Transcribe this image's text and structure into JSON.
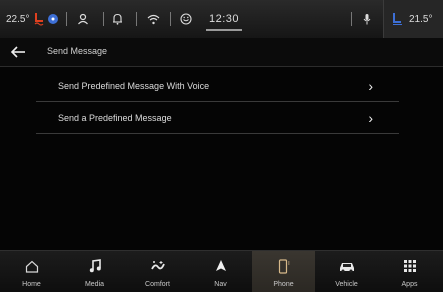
{
  "status": {
    "temp_left": "22.5°",
    "clock": "12:30",
    "temp_right": "21.5°"
  },
  "header": {
    "title": "Send Message"
  },
  "menu": {
    "items": [
      {
        "label": "Send Predefined Message With Voice"
      },
      {
        "label": "Send a Predefined Message"
      }
    ]
  },
  "nav": {
    "items": [
      {
        "label": "Home",
        "icon": "home-icon"
      },
      {
        "label": "Media",
        "icon": "music-note-icon"
      },
      {
        "label": "Comfort",
        "icon": "climate-icon"
      },
      {
        "label": "Nav",
        "icon": "navigation-arrow-icon"
      },
      {
        "label": "Phone",
        "icon": "phone-icon"
      },
      {
        "label": "Vehicle",
        "icon": "car-icon"
      },
      {
        "label": "Apps",
        "icon": "apps-grid-icon"
      }
    ],
    "active": "Phone"
  },
  "colors": {
    "accent_heat": "#e0401f",
    "accent_fan": "#3d6fd6",
    "active_tab": "#3a3630"
  }
}
